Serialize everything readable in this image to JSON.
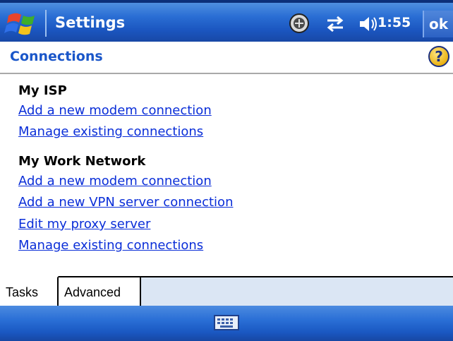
{
  "titlebar": {
    "start_icon": "windows-flag-icon",
    "title": "Settings",
    "status_icons": [
      "connectivity-icon",
      "sync-arrows-icon",
      "volume-icon"
    ],
    "clock": "1:55",
    "ok_label": "ok"
  },
  "page": {
    "title": "Connections",
    "help_icon": "help-question-icon"
  },
  "sections": [
    {
      "heading": "My ISP",
      "links": [
        "Add a new modem connection",
        "Manage existing connections"
      ]
    },
    {
      "heading": "My Work Network",
      "links": [
        "Add a new modem connection",
        "Add a new VPN server connection",
        "Edit my proxy server",
        "Manage existing connections"
      ]
    }
  ],
  "tabs": [
    {
      "label": "Tasks",
      "selected": true
    },
    {
      "label": "Advanced",
      "selected": false
    }
  ],
  "menubar": {
    "input_icon": "keyboard-icon"
  },
  "colors": {
    "titlebar_blue": "#1b56c0",
    "link_blue": "#0a2ed8",
    "page_title_blue": "#1a56c9",
    "tab_strip_bg": "#dbe6f4"
  }
}
